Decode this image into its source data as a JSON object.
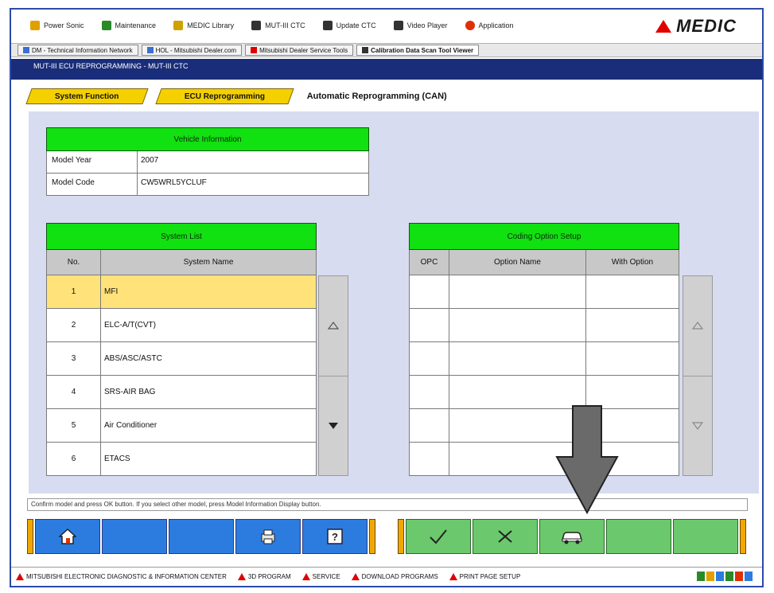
{
  "toolbar": {
    "items": [
      {
        "label": "Power Sonic",
        "icon": "lightning-icon",
        "color": "#e0a000"
      },
      {
        "label": "Maintenance",
        "icon": "wrench-icon",
        "color": "#2a8a2a"
      },
      {
        "label": "MEDIC Library",
        "icon": "library-icon",
        "color": "#d0a000"
      },
      {
        "label": "MUT-III CTC",
        "icon": "mut-icon",
        "color": "#333333"
      },
      {
        "label": "Update CTC",
        "icon": "update-icon",
        "color": "#333333"
      },
      {
        "label": "Video Player",
        "icon": "video-icon",
        "color": "#333333"
      },
      {
        "label": "Application",
        "icon": "app-icon",
        "color": "#e03000"
      }
    ],
    "brand": "MEDIC"
  },
  "tabs": [
    {
      "label": "DM - Technical Information Network",
      "active": false
    },
    {
      "label": "HOL - Mitsubishi Dealer.com",
      "active": false
    },
    {
      "label": "Mitsubishi Dealer Service Tools",
      "active": false
    },
    {
      "label": "Calibration Data Scan Tool Viewer",
      "active": true
    }
  ],
  "path": "MUT-III  ECU REPROGRAMMING - MUT-III CTC",
  "function_tabs": {
    "system_function": "System Function",
    "ecu_reprogramming": "ECU Reprogramming",
    "current": "Automatic Reprogramming (CAN)"
  },
  "vehicle_info": {
    "title": "Vehicle Information",
    "rows": [
      {
        "key": "Model Year",
        "value": "2007"
      },
      {
        "key": "Model Code",
        "value": "CW5WRL5YCLUF"
      }
    ]
  },
  "systems": {
    "title": "System List",
    "col_no": "No.",
    "col_name": "System Name",
    "rows": [
      {
        "no": "1",
        "name": "MFI",
        "selected": true
      },
      {
        "no": "2",
        "name": "ELC-A/T(CVT)",
        "selected": false
      },
      {
        "no": "3",
        "name": "ABS/ASC/ASTC",
        "selected": false
      },
      {
        "no": "4",
        "name": "SRS-AIR BAG",
        "selected": false
      },
      {
        "no": "5",
        "name": "Air Conditioner",
        "selected": false
      },
      {
        "no": "6",
        "name": "ETACS",
        "selected": false
      }
    ]
  },
  "coding_options": {
    "title": "Coding Option Setup",
    "col_opc": "OPC",
    "col_name": "Option Name",
    "col_with": "With Option"
  },
  "hint": "Confirm model and press OK button. If you select other model, press Model Information Display button.",
  "status_bar": {
    "items": [
      "MITSUBISHI ELECTRONIC DIAGNOSTIC & INFORMATION CENTER",
      "3D PROGRAM",
      "SERVICE",
      "DOWNLOAD PROGRAMS",
      "PRINT PAGE SETUP"
    ]
  },
  "colors": {
    "header_green": "#11e011",
    "selected_row": "#ffe27a",
    "button_blue": "#2c7ce0",
    "button_green": "#6cc86c",
    "path_bar": "#1a2d7a"
  }
}
